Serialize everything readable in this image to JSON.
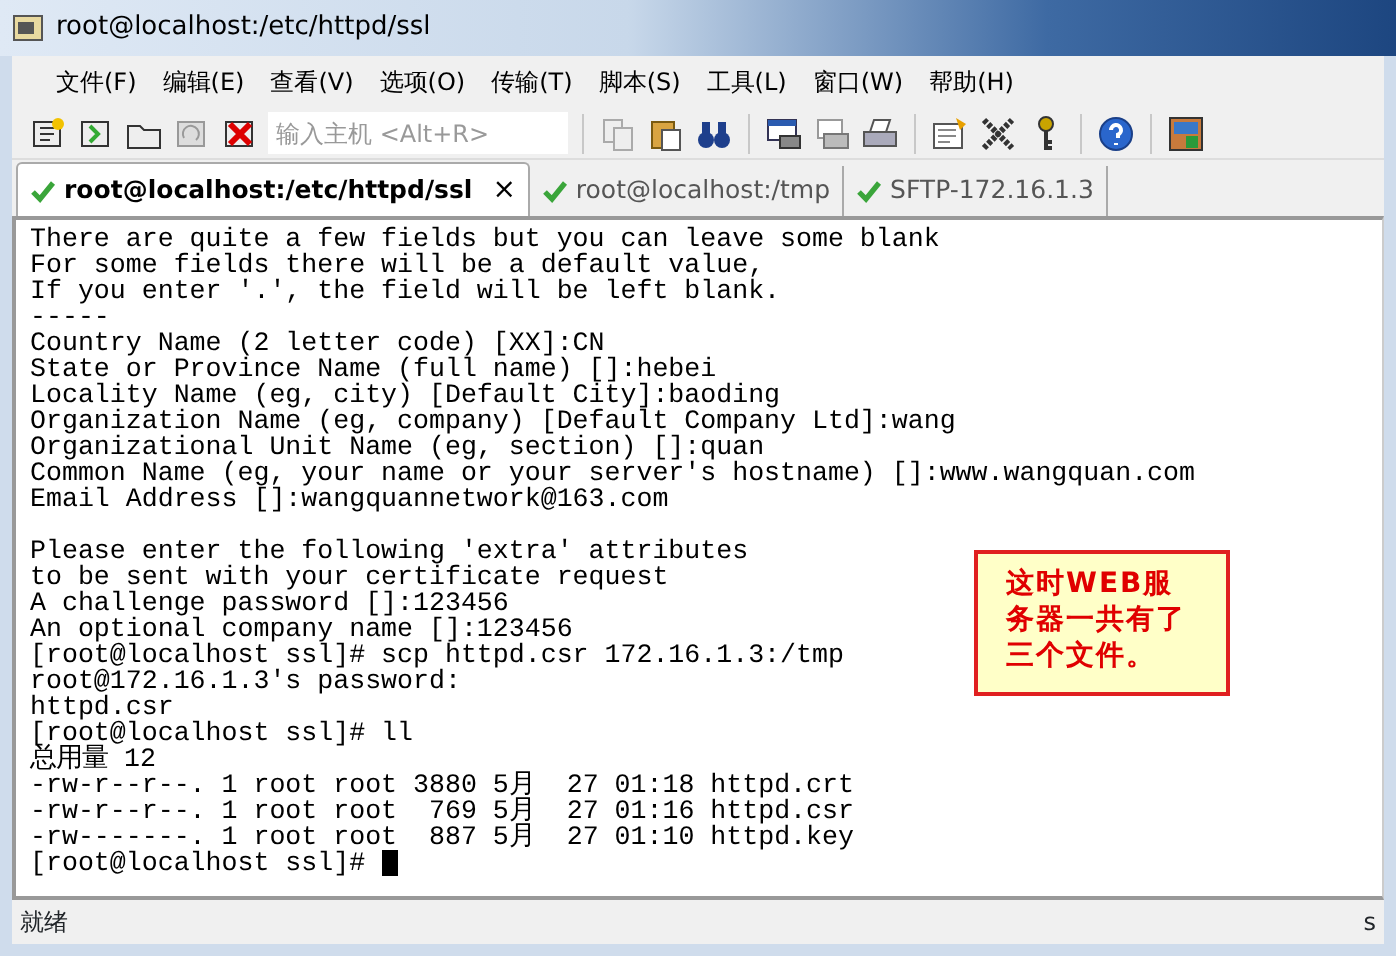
{
  "window": {
    "title": "root@localhost:/etc/httpd/ssl"
  },
  "menu": [
    "文件(F)",
    "编辑(E)",
    "查看(V)",
    "选项(O)",
    "传输(T)",
    "脚本(S)",
    "工具(L)",
    "窗口(W)",
    "帮助(H)"
  ],
  "toolbar": {
    "host_field": {
      "placeholder": "输入主机 <Alt+R>"
    }
  },
  "tabs": [
    {
      "label": "root@localhost:/etc/httpd/ssl",
      "selected": true,
      "connected": true,
      "close": "×"
    },
    {
      "label": "root@localhost:/tmp",
      "selected": false,
      "connected": true
    },
    {
      "label": "SFTP-172.16.1.3",
      "selected": false,
      "connected": true
    }
  ],
  "terminal": {
    "blocks": [
      [
        "There are quite a few fields but you can leave some blank",
        "For some fields there will be a default value,",
        "If you enter '.', the field will be left blank.",
        "-----",
        "Country Name (2 letter code) [XX]:CN",
        "State or Province Name (full name) []:hebei",
        "Locality Name (eg, city) [Default City]:baoding",
        "Organization Name (eg, company) [Default Company Ltd]:wang",
        "Organizational Unit Name (eg, section) []:quan",
        "Common Name (eg, your name or your server's hostname) []:www.wangquan.com",
        "Email Address []:wangquannetwork@163.com"
      ],
      [
        "Please enter the following 'extra' attributes",
        "to be sent with your certificate request",
        "A challenge password []:123456",
        "An optional company name []:123456",
        "[root@localhost ssl]# scp httpd.csr 172.16.1.3:/tmp",
        "root@172.16.1.3's password:",
        "httpd.csr",
        "[root@localhost ssl]# ll",
        "总用量 12",
        "-rw-r--r--. 1 root root 3880 5月  27 01:18 httpd.crt",
        "-rw-r--r--. 1 root root  769 5月  27 01:16 httpd.csr",
        "-rw-------. 1 root root  887 5月  27 01:10 httpd.key",
        "[root@localhost ssl]# "
      ]
    ],
    "cursor": true
  },
  "callout": {
    "text": "这时WEB服务器一共有了三个文件。"
  },
  "status_bar": {
    "text": "就绪",
    "right": "s"
  }
}
